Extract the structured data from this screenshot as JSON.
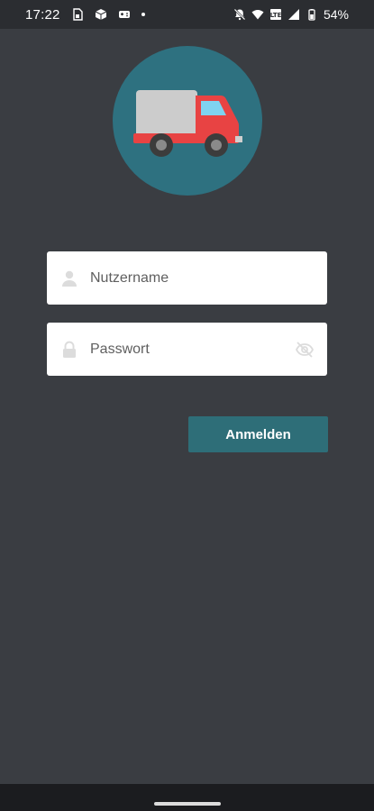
{
  "status_bar": {
    "time": "17:22",
    "left_icons": [
      "sim-card-icon",
      "package-icon",
      "gamepad-icon"
    ],
    "right_icons": [
      "notifications-off-icon",
      "wifi-icon",
      "data-icon",
      "signal-icon",
      "battery-icon"
    ],
    "battery": "54%"
  },
  "logo": {
    "icon": "delivery-truck-icon",
    "background_color": "#2e7180",
    "truck_body_color": "#e84343",
    "cargo_color": "#cccccc"
  },
  "login_form": {
    "username": {
      "placeholder": "Nutzername",
      "value": "",
      "icon": "person-icon"
    },
    "password": {
      "placeholder": "Passwort",
      "value": "",
      "icon": "lock-icon",
      "toggle_icon": "visibility-off-icon"
    },
    "submit_label": "Anmelden"
  },
  "colors": {
    "background": "#3a3d42",
    "accent": "#2e6e78"
  }
}
